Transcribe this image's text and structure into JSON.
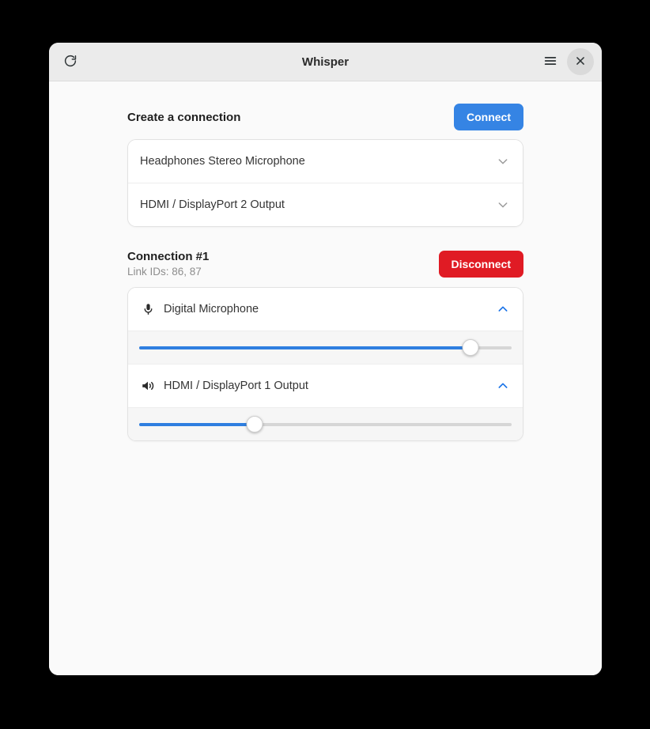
{
  "window": {
    "title": "Whisper",
    "titlebar": {
      "refresh_icon": "refresh-icon",
      "menu_icon": "hamburger-menu-icon",
      "close_icon": "close-icon"
    }
  },
  "create_section": {
    "title": "Create a connection",
    "connect_label": "Connect",
    "connect_color": "#3584e4",
    "devices": [
      {
        "label": "Headphones Stereo Microphone",
        "chevron": "chevron-down-icon",
        "expanded": false
      },
      {
        "label": "HDMI / DisplayPort 2 Output",
        "chevron": "chevron-down-icon",
        "expanded": false
      }
    ]
  },
  "connection_section": {
    "title": "Connection #1",
    "subtitle": "Link IDs: 86, 87",
    "disconnect_label": "Disconnect",
    "disconnect_color": "#e01b24",
    "devices": [
      {
        "label": "Digital Microphone",
        "icon": "microphone-icon",
        "chevron": "chevron-up-icon",
        "expanded": true,
        "volume_percent": 89
      },
      {
        "label": "HDMI / DisplayPort 1 Output",
        "icon": "speaker-icon",
        "chevron": "chevron-up-icon",
        "expanded": true,
        "volume_percent": 31
      }
    ]
  }
}
